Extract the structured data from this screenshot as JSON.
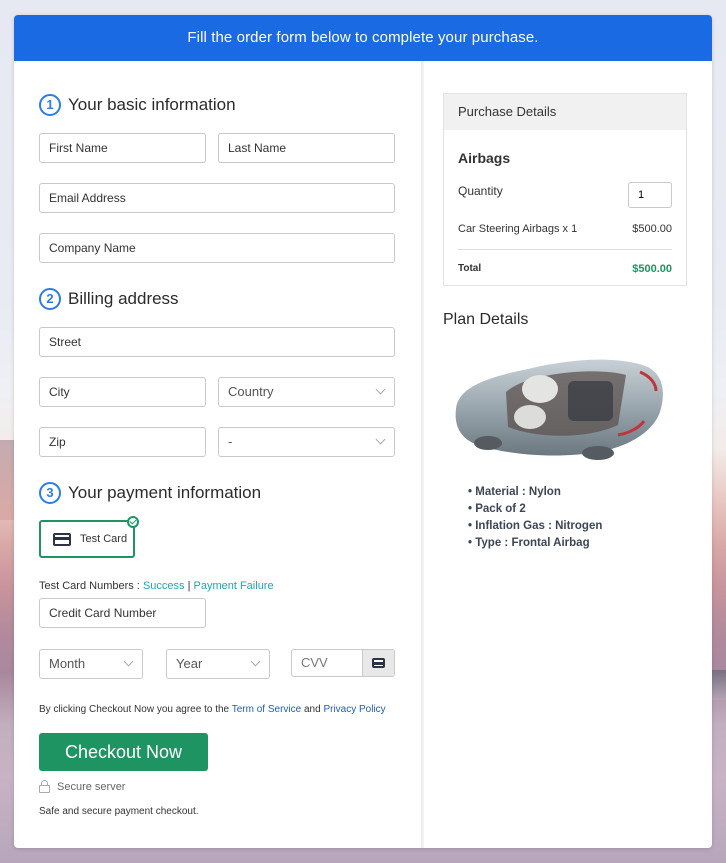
{
  "banner": {
    "text": "Fill the order form below to complete your purchase."
  },
  "sections": {
    "basic": {
      "number": "1",
      "title": "Your basic information"
    },
    "billing": {
      "number": "2",
      "title": "Billing address"
    },
    "payment": {
      "number": "3",
      "title": "Your payment information"
    }
  },
  "fields": {
    "first_name": {
      "placeholder": "First Name"
    },
    "last_name": {
      "placeholder": "Last Name"
    },
    "email": {
      "placeholder": "Email Address"
    },
    "company": {
      "placeholder": "Company Name"
    },
    "street": {
      "placeholder": "Street"
    },
    "city": {
      "placeholder": "City"
    },
    "country": {
      "selected": "Country"
    },
    "zip": {
      "placeholder": "Zip"
    },
    "state": {
      "selected": "-"
    },
    "card_number": {
      "placeholder": "Credit Card Number"
    },
    "month": {
      "selected": "Month"
    },
    "year": {
      "selected": "Year"
    },
    "cvv": {
      "placeholder": "CVV"
    }
  },
  "payment": {
    "method_label": "Test Card",
    "test_numbers_label": "Test Card Numbers :",
    "success_link": "Success",
    "separator": "|",
    "failure_link": "Payment Failure"
  },
  "terms": {
    "prefix": "By clicking Checkout Now you agree to the",
    "tos_link": "Term of Service",
    "and": "and",
    "privacy_link": "Privacy Policy"
  },
  "checkout": {
    "button_label": "Checkout Now",
    "secure_label": "Secure server",
    "safe_text": "Safe and secure payment checkout."
  },
  "purchase": {
    "header": "Purchase Details",
    "product": "Airbags",
    "quantity_label": "Quantity",
    "quantity_value": "1",
    "line_item": "Car Steering Airbags x 1",
    "line_price": "$500.00",
    "total_label": "Total",
    "total_value": "$500.00",
    "total_color": "#1e9463"
  },
  "plan": {
    "title": "Plan Details",
    "image_alt": "car-airbag-image",
    "features": [
      "Material : Nylon",
      "Pack of 2",
      "Inflation Gas : Nitrogen",
      "Type : Frontal Airbag"
    ]
  },
  "colors": {
    "brand_blue": "#1a6ae3",
    "accent_green": "#1e9463",
    "link_teal": "#23a5b5"
  }
}
